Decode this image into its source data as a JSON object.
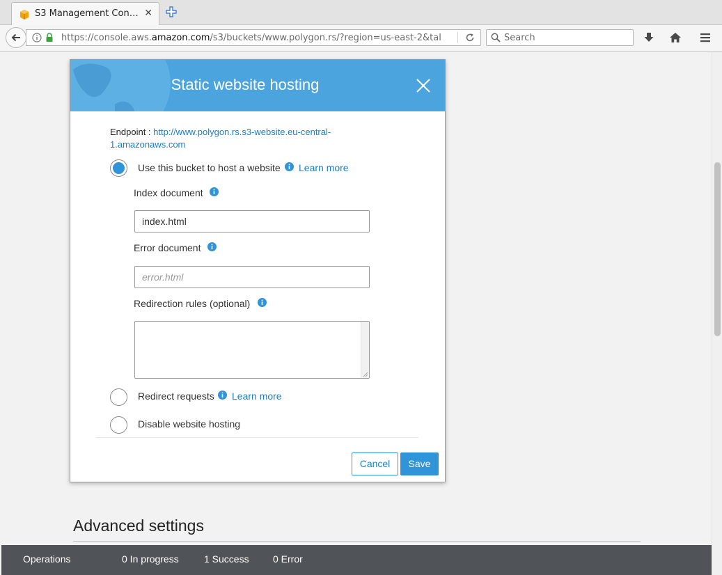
{
  "browser": {
    "tab": {
      "title": "S3 Management Con…",
      "favicon": "aws-box-icon"
    },
    "url": {
      "prefix": "https://console.aws.",
      "domain": "amazon.com",
      "path": "/s3/buckets/www.polygon.rs/?region=us-east-2&tal"
    },
    "search_placeholder": "Search"
  },
  "modal": {
    "title": "Static website hosting",
    "endpoint_label": "Endpoint : ",
    "endpoint_url": "http://www.polygon.rs.s3-website.eu-central-1.amazonaws.com",
    "options": [
      {
        "label": "Use this bucket to host a website",
        "checked": true,
        "learn_more": "Learn more"
      },
      {
        "label": "Redirect requests",
        "checked": false,
        "learn_more": "Learn more"
      },
      {
        "label": "Disable website hosting",
        "checked": false
      }
    ],
    "index_document": {
      "label": "Index document",
      "value": "index.html"
    },
    "error_document": {
      "label": "Error document",
      "placeholder": "error.html"
    },
    "redirection_rules": {
      "label": "Redirection rules (optional)",
      "value": ""
    },
    "cancel_label": "Cancel",
    "save_label": "Save"
  },
  "page": {
    "section_title": "Advanced settings"
  },
  "operations_bar": {
    "label": "Operations",
    "in_progress": "0 In progress",
    "success": "1 Success",
    "error": "0 Error"
  },
  "colors": {
    "header_blue": "#4ca4de",
    "link_blue": "#1a80c4",
    "button_blue": "#2f94d8",
    "ops_bar": "#505458"
  }
}
